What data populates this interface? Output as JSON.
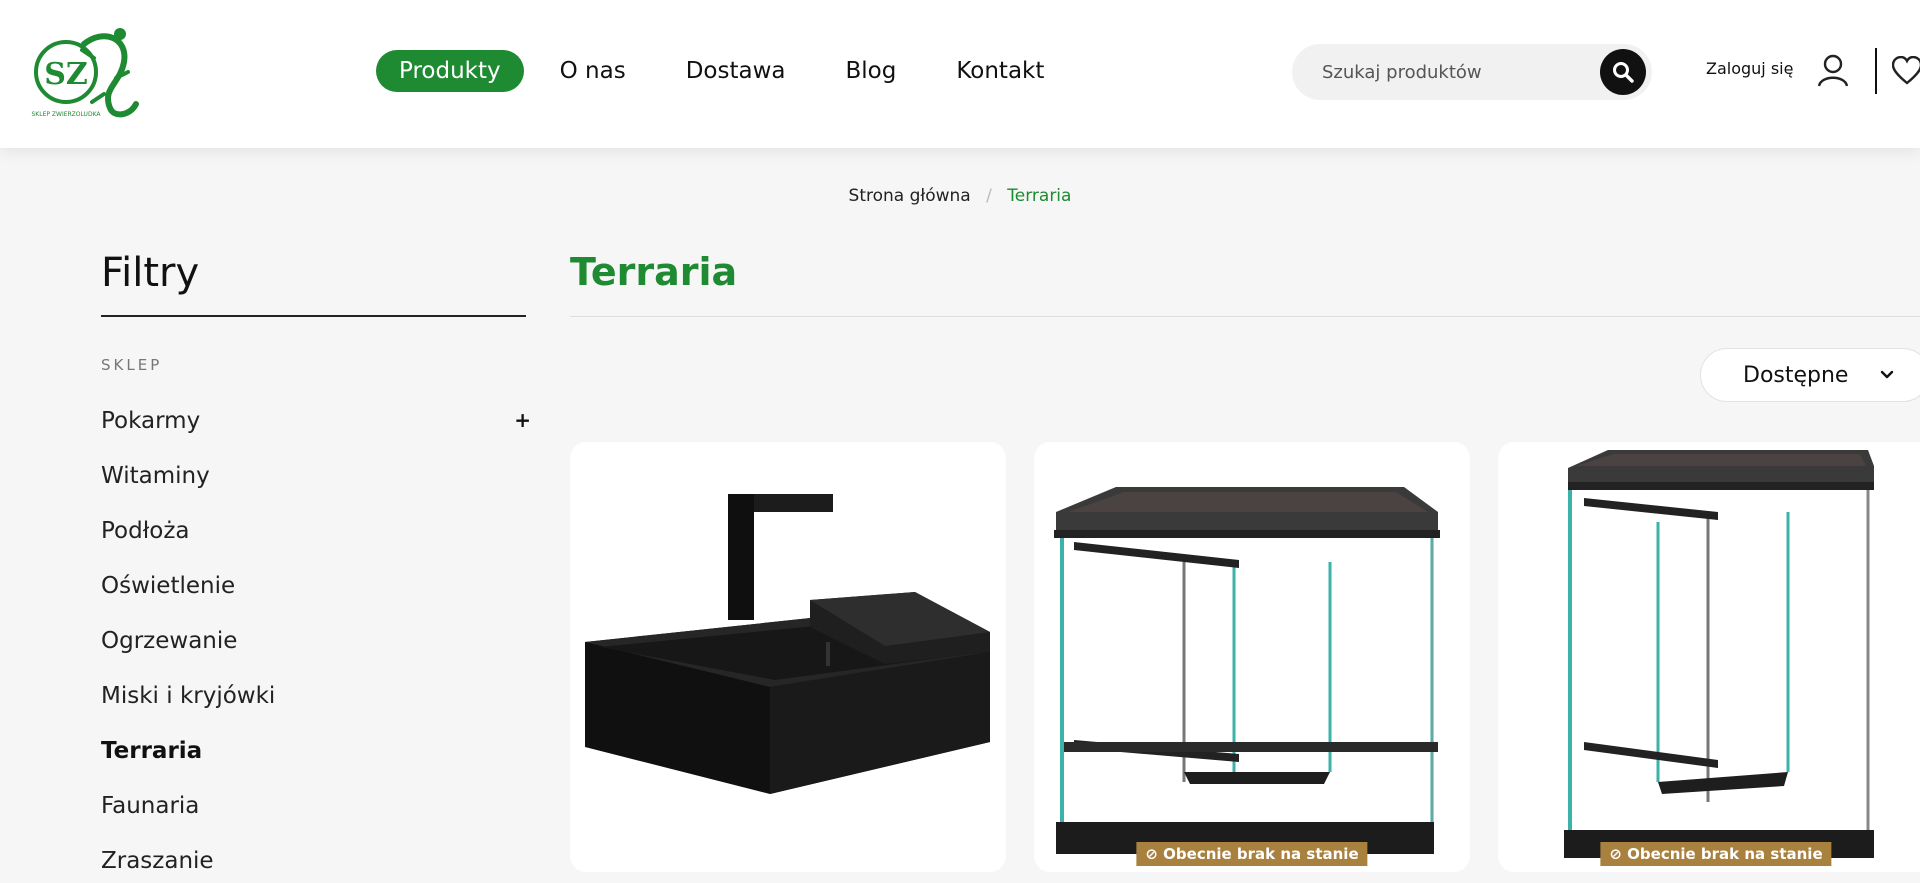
{
  "header": {
    "logo_text": "SZ",
    "logo_subtitle": "SKLEP ZWIERZOLUDKA",
    "nav": [
      "Produkty",
      "O nas",
      "Dostawa",
      "Blog",
      "Kontakt"
    ],
    "active_nav": "Produkty",
    "search_placeholder": "Szukaj produktów",
    "login_label": "Zaloguj się"
  },
  "breadcrumb": {
    "home": "Strona główna",
    "separator": "/",
    "current": "Terraria"
  },
  "filters": {
    "title": "Filtry",
    "section_label": "SKLEP",
    "categories": [
      "Pokarmy",
      "Witaminy",
      "Podłoża",
      "Oświetlenie",
      "Ogrzewanie",
      "Miski i kryjówki",
      "Terraria",
      "Faunaria",
      "Zraszanie"
    ],
    "active_category": "Terraria",
    "expandable_label": "+"
  },
  "main": {
    "title": "Terraria",
    "sort_label": "Dostępne",
    "products": [
      {
        "image": "black-turtle-tank",
        "badge": ""
      },
      {
        "image": "glass-terrarium",
        "badge": "⊘ Obecnie brak na stanie"
      },
      {
        "image": "tall-glass-terrarium",
        "badge": "⊘ Obecnie brak na stanie"
      }
    ]
  },
  "colors": {
    "accent": "#1e8a32",
    "badge": "#a8813f",
    "background": "#f6f6f6"
  }
}
